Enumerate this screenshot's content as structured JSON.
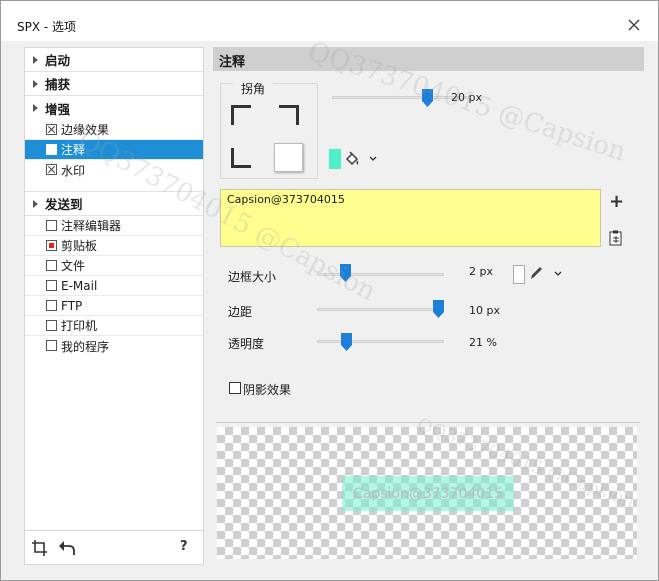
{
  "window": {
    "title": "SPX - 选项"
  },
  "sidebar": {
    "sections": [
      {
        "label": "启动"
      },
      {
        "label": "捕获"
      },
      {
        "label": "增强",
        "items": [
          {
            "label": "边缘效果",
            "state": "checked"
          },
          {
            "label": "注释",
            "state": "selected"
          },
          {
            "label": "水印",
            "state": "checked"
          }
        ]
      },
      {
        "label": "发送到",
        "items": [
          {
            "label": "注释编辑器",
            "state": "unchecked"
          },
          {
            "label": "剪贴板",
            "state": "active"
          },
          {
            "label": "文件",
            "state": "unchecked"
          },
          {
            "label": "E-Mail",
            "state": "unchecked"
          },
          {
            "label": "FTP",
            "state": "unchecked"
          },
          {
            "label": "打印机",
            "state": "unchecked"
          },
          {
            "label": "我的程序",
            "state": "unchecked"
          }
        ]
      }
    ],
    "footer": {
      "help_label": "?"
    }
  },
  "panel": {
    "header": "注释",
    "corner": {
      "label": "拐角",
      "radius": {
        "value": "20 px",
        "level": 0.8
      }
    },
    "color": {
      "accent": "#4ff0c8"
    },
    "text": {
      "value": "Capsion@373704015"
    },
    "add_label": "+",
    "border": {
      "label": "边框大小",
      "value": "2 px",
      "level": 0.2
    },
    "margin": {
      "label": "边距",
      "value": "10 px",
      "level": 1.0
    },
    "opacity": {
      "label": "透明度",
      "value": "21 %",
      "level": 0.21
    },
    "shadow": {
      "label": "阴影效果",
      "checked": false
    },
    "preview": {
      "stamp_text": "Capsion@373704015"
    }
  },
  "watermark": {
    "text": "QQ373704015 @Capsion"
  }
}
